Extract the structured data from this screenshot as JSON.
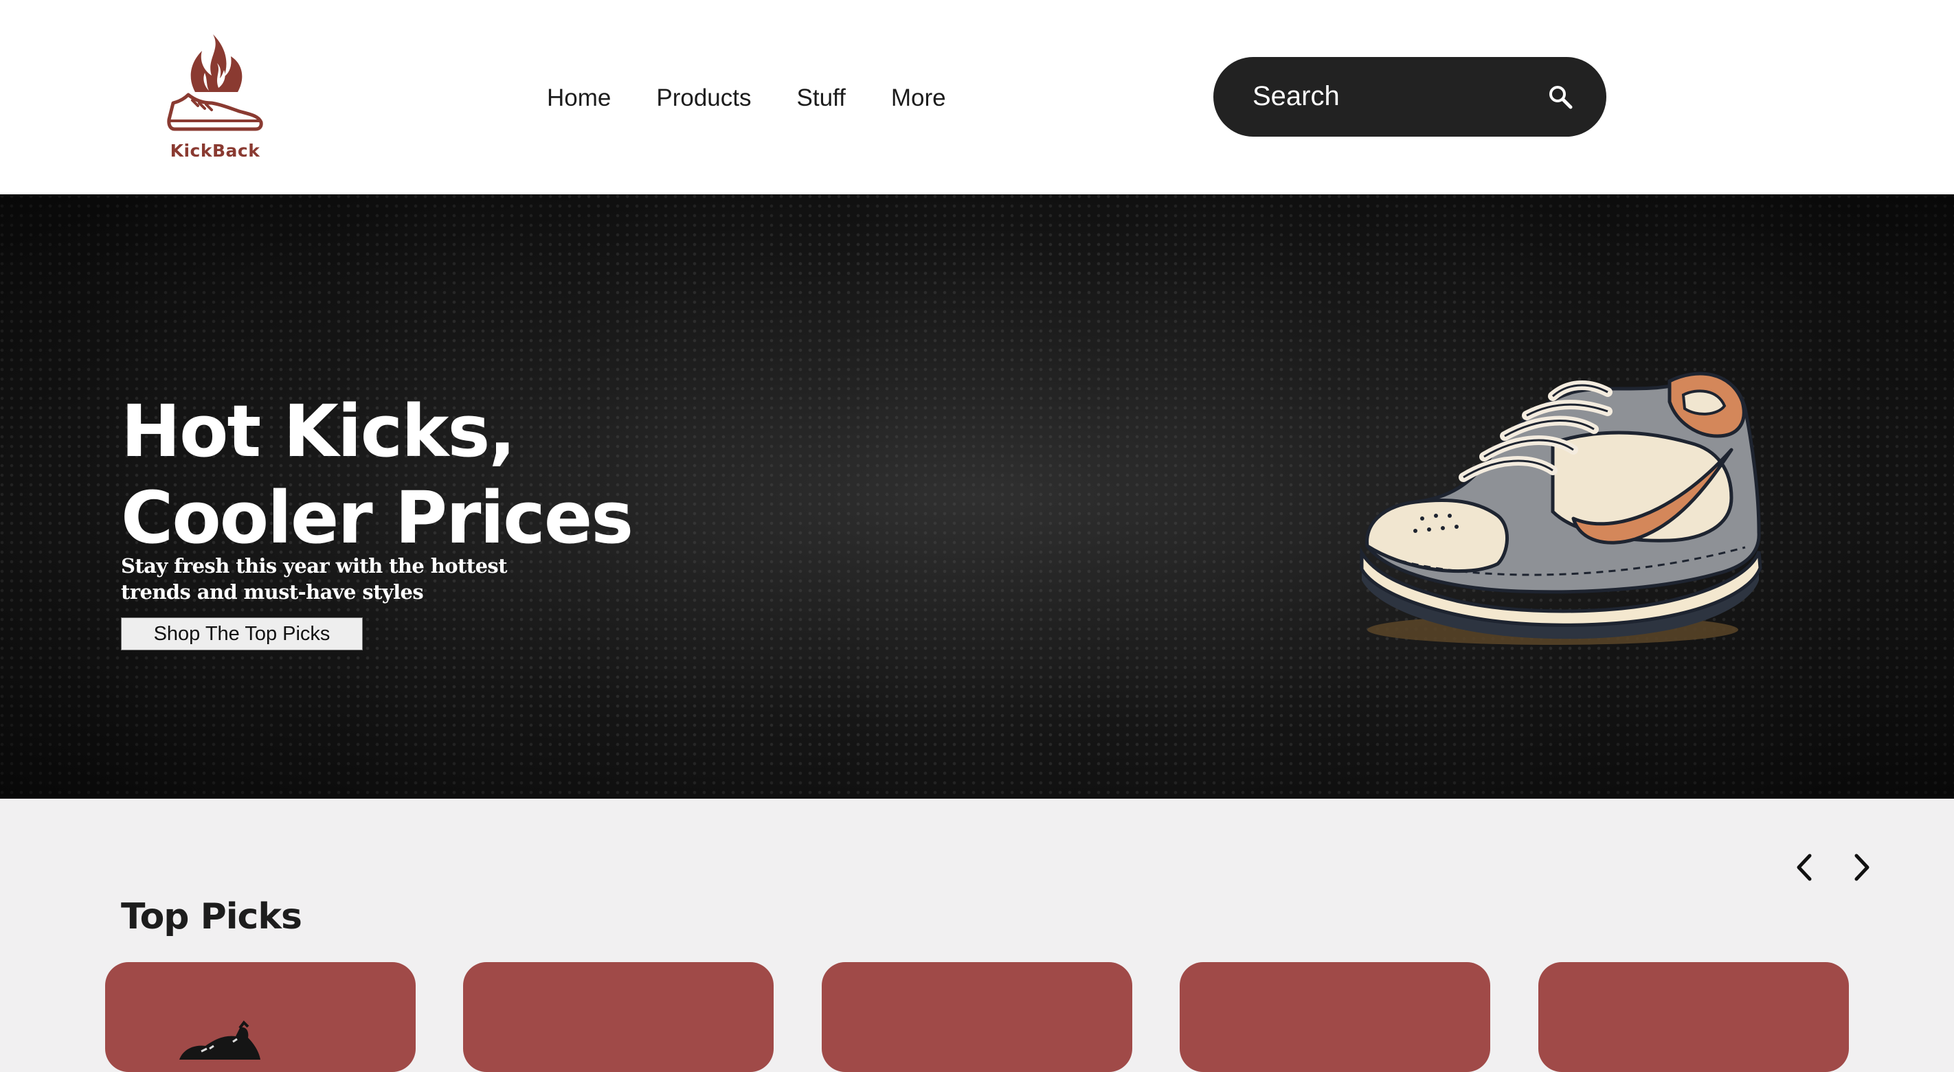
{
  "brand": {
    "name": "KickBack",
    "colors": {
      "logo": "#8a3a31",
      "accent": "#a04a48",
      "search_bg": "#222222"
    }
  },
  "nav": {
    "items": [
      {
        "label": "Home"
      },
      {
        "label": "Products"
      },
      {
        "label": "Stuff"
      },
      {
        "label": "More"
      }
    ]
  },
  "search": {
    "placeholder": "Search",
    "icon": "search-icon"
  },
  "hero": {
    "title_line1": "Hot Kicks,",
    "title_line2": "Cooler Prices",
    "subtitle_line1": "Stay fresh this year with the hottest",
    "subtitle_line2": "trends and must-have styles",
    "cta_label": "Shop The Top Picks",
    "image": "sneaker-illustration"
  },
  "top_picks": {
    "title": "Top Picks",
    "prev_icon": "chevron-left-icon",
    "next_icon": "chevron-right-icon",
    "cards": [
      {
        "image": "sneaker-thumbnail"
      },
      {
        "image": ""
      },
      {
        "image": ""
      },
      {
        "image": ""
      },
      {
        "image": ""
      }
    ]
  }
}
